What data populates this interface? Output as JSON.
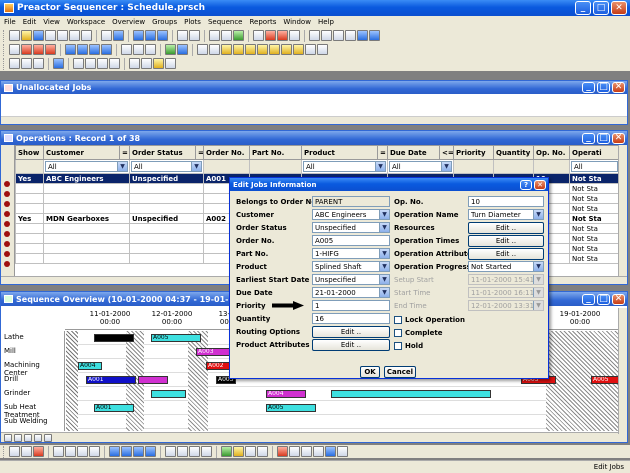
{
  "app": {
    "title": "Preactor Sequencer : Schedule.prsch"
  },
  "menu": [
    "File",
    "Edit",
    "View",
    "Workspace",
    "Overview",
    "Groups",
    "Plots",
    "Sequence",
    "Reports",
    "Window",
    "Help"
  ],
  "unallocated": {
    "title": "Unallocated Jobs"
  },
  "operations": {
    "title": "Operations : Record 1 of 38",
    "columns": [
      "Show",
      "Customer",
      "=",
      "Order Status",
      "=",
      "Order No.",
      "Part No.",
      "Product",
      "=",
      "Due Date",
      "<=",
      "Priority",
      "Quantity",
      "Op. No.",
      "Operati"
    ],
    "filters": {
      "customer": "All",
      "order_status": "All",
      "product": "All",
      "due_date": "All",
      "operation": "All"
    },
    "rows": [
      {
        "show": "Yes",
        "customer": "ABC Engineers",
        "status": "Unspecified",
        "order": "A001",
        "op": "10",
        "opstatus": "Not Sta"
      },
      {
        "show": "",
        "customer": "",
        "status": "",
        "order": "",
        "op": "20",
        "opstatus": "Not Sta"
      },
      {
        "show": "",
        "customer": "",
        "status": "",
        "order": "",
        "op": "30",
        "opstatus": "Not Sta"
      },
      {
        "show": "",
        "customer": "",
        "status": "",
        "order": "",
        "op": "40",
        "opstatus": "Not Sta"
      },
      {
        "show": "Yes",
        "customer": "MDN Gearboxes",
        "status": "Unspecified",
        "order": "A002",
        "op": "50",
        "opstatus": "Not Sta"
      },
      {
        "show": "",
        "customer": "",
        "status": "",
        "order": "",
        "op": "10",
        "opstatus": "Not Sta"
      },
      {
        "show": "",
        "customer": "",
        "status": "",
        "order": "",
        "op": "20",
        "opstatus": "Not Sta"
      },
      {
        "show": "",
        "customer": "",
        "status": "",
        "order": "",
        "op": "30",
        "opstatus": "Not Sta"
      },
      {
        "show": "",
        "customer": "",
        "status": "",
        "order": "",
        "op": "40",
        "opstatus": "Not Sta"
      }
    ]
  },
  "dialog": {
    "title": "Edit Jobs Information",
    "left": [
      {
        "label": "Belongs to Order No.",
        "value": "PARENT",
        "type": "text"
      },
      {
        "label": "Customer",
        "value": "ABC Engineers",
        "type": "select"
      },
      {
        "label": "Order Status",
        "value": "Unspecified",
        "type": "select"
      },
      {
        "label": "Order No.",
        "value": "A005",
        "type": "text"
      },
      {
        "label": "Part No.",
        "value": "1-HIFG",
        "type": "select"
      },
      {
        "label": "Product",
        "value": "Splined Shaft",
        "type": "select"
      },
      {
        "label": "Earliest Start Date",
        "value": "Unspecified",
        "type": "select"
      },
      {
        "label": "Due Date",
        "value": "21-01-2000",
        "type": "select"
      },
      {
        "label": "Priority",
        "value": "1",
        "type": "text"
      },
      {
        "label": "Quantity",
        "value": "16",
        "type": "text"
      },
      {
        "label": "Routing Options",
        "value": "Edit ..",
        "type": "button"
      },
      {
        "label": "Product Attributes",
        "value": "Edit ..",
        "type": "button"
      }
    ],
    "right": [
      {
        "label": "Op. No.",
        "value": "10",
        "type": "text"
      },
      {
        "label": "Operation Name",
        "value": "Turn Diameter",
        "type": "select"
      },
      {
        "label": "Resources",
        "value": "Edit ..",
        "type": "button"
      },
      {
        "label": "Operation Times",
        "value": "Edit ..",
        "type": "button"
      },
      {
        "label": "Operation Attributes",
        "value": "Edit ..",
        "type": "button"
      },
      {
        "label": "Operation Progress",
        "value": "Not Started",
        "type": "select"
      },
      {
        "label": "Setup Start",
        "value": "11-01-2000 15:41",
        "type": "disabled"
      },
      {
        "label": "Start Time",
        "value": "11-01-2000 16:11",
        "type": "disabled"
      },
      {
        "label": "End Time",
        "value": "12-01-2000 13:31",
        "type": "disabled"
      }
    ],
    "checks": [
      "Lock Operation",
      "Complete",
      "Hold"
    ],
    "ok": "OK",
    "cancel": "Cancel"
  },
  "gantt": {
    "title": "Sequence Overview   (10-01-2000 04:37 - 19-01-2000 ...",
    "dates": [
      {
        "d": "11-01-2000",
        "t": "00:00"
      },
      {
        "d": "12-01-2000",
        "t": "00:00"
      },
      {
        "d": "13-01-",
        "t": "00:00"
      },
      {
        "d": "19-01-2000",
        "t": "00:00"
      }
    ],
    "resources": [
      "Lathe",
      "Mill",
      "Machining Center",
      "Drill",
      "Grinder",
      "Sub Heat Treatment",
      "Sub Welding"
    ],
    "bars": [
      "A005",
      "A003",
      "A004",
      "A002",
      "A001",
      "A003",
      "A005",
      "A005",
      "A004",
      "A006",
      "A007",
      "A005",
      "A003"
    ]
  },
  "status": {
    "text": "Edit Jobs"
  },
  "colors": {
    "title_blue": "#0a5adf",
    "selected_row": "#0a246a",
    "bar_cyan": "#3ee0e0",
    "bar_blue": "#1010c8",
    "bar_red": "#e01010",
    "bar_magenta": "#d030d0"
  }
}
